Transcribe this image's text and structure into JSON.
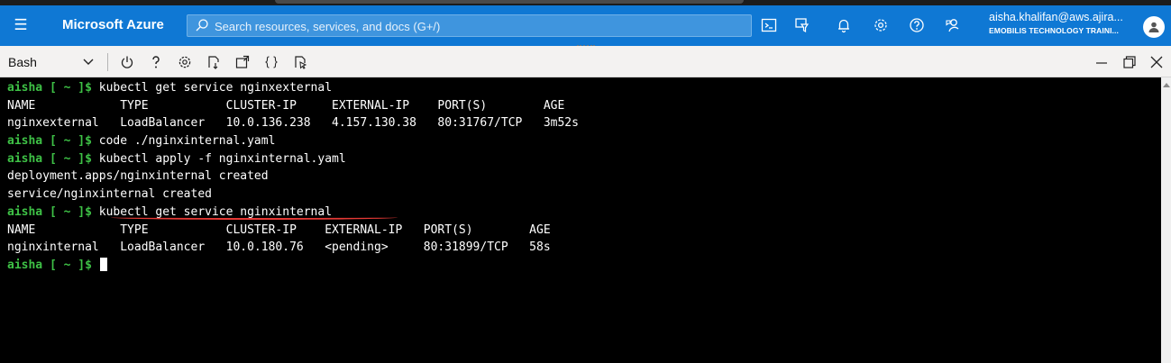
{
  "header": {
    "menu_icon": "hamburger-menu-icon",
    "brand": "Microsoft Azure",
    "search_placeholder": "Search resources, services, and docs (G+/)",
    "icons": [
      "cloud-shell-icon",
      "directory-filter-icon",
      "notifications-bell-icon",
      "settings-gear-icon",
      "help-question-icon",
      "feedback-icon"
    ],
    "account_email": "aisha.khalifan@aws.ajira...",
    "account_org": "EMOBILIS TECHNOLOGY TRAINI...",
    "colors": {
      "bar": "#0f78d4"
    }
  },
  "shell_toolbar": {
    "shell": "Bash",
    "buttons": [
      {
        "icon": "power-restart-icon",
        "glyph": "⏻"
      },
      {
        "icon": "help-icon",
        "glyph": "?"
      },
      {
        "icon": "settings-icon",
        "glyph": "⚙"
      },
      {
        "icon": "upload-download-icon",
        "glyph": ""
      },
      {
        "icon": "open-new-session-icon",
        "glyph": ""
      },
      {
        "icon": "editor-braces-icon",
        "glyph": "{}"
      },
      {
        "icon": "web-preview-icon",
        "glyph": ""
      }
    ],
    "window_controls": [
      "minimize-icon",
      "maximize-icon",
      "close-icon"
    ]
  },
  "terminal": {
    "colors": {
      "prompt": "#3ec146",
      "text": "#ffffff",
      "background": "#000000",
      "annotation": "#e53935"
    },
    "lines": [
      {
        "prompt": "aisha [ ~ ]$ ",
        "text": "kubectl get service nginxexternal"
      },
      {
        "prompt": "",
        "text": "NAME            TYPE           CLUSTER-IP     EXTERNAL-IP    PORT(S)        AGE"
      },
      {
        "prompt": "",
        "text": "nginxexternal   LoadBalancer   10.0.136.238   4.157.130.38   80:31767/TCP   3m52s"
      },
      {
        "prompt": "aisha [ ~ ]$ ",
        "text": "code ./nginxinternal.yaml"
      },
      {
        "prompt": "aisha [ ~ ]$ ",
        "text": "kubectl apply -f nginxinternal.yaml"
      },
      {
        "prompt": "",
        "text": "deployment.apps/nginxinternal created"
      },
      {
        "prompt": "",
        "text": "service/nginxinternal created"
      },
      {
        "prompt": "aisha [ ~ ]$ ",
        "text": "kubectl get service nginxinternal"
      },
      {
        "prompt": "",
        "text": "NAME            TYPE           CLUSTER-IP    EXTERNAL-IP   PORT(S)        AGE"
      },
      {
        "prompt": "",
        "text": "nginxinternal   LoadBalancer   10.0.180.76   <pending>     80:31899/TCP   58s"
      },
      {
        "prompt": "aisha [ ~ ]$ ",
        "text": ""
      }
    ]
  }
}
